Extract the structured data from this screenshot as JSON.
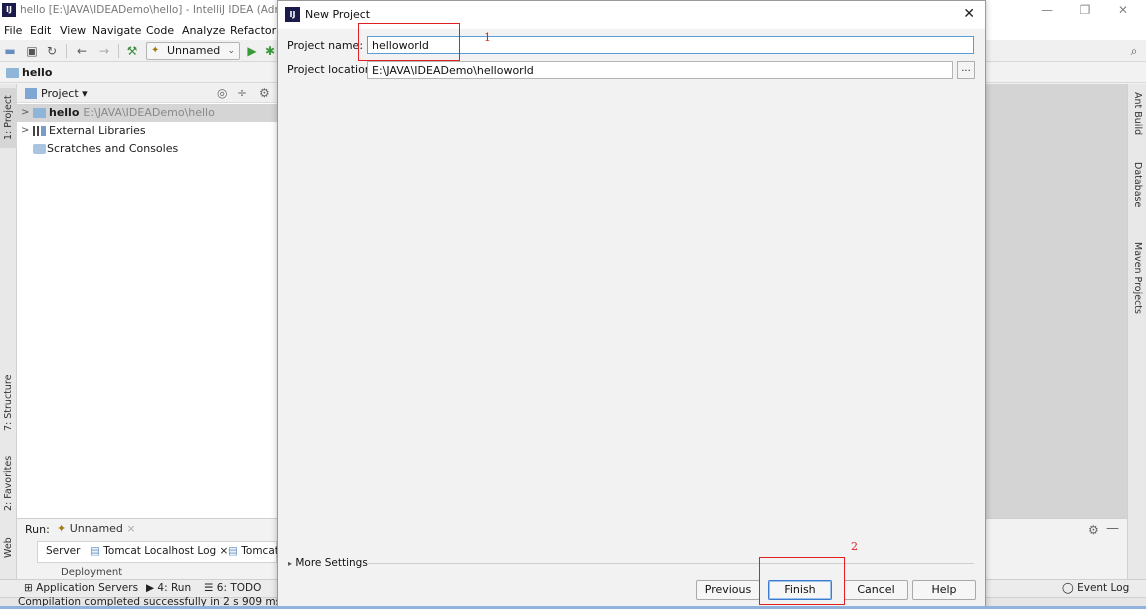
{
  "ide": {
    "title": "hello [E:\\JAVA\\IDEADemo\\hello] - IntelliJ IDEA (Admir",
    "app_icon": "IJ",
    "window_controls": {
      "minimize": "—",
      "maximize": "❐",
      "close": "✕"
    },
    "menu": [
      "File",
      "Edit",
      "View",
      "Navigate",
      "Code",
      "Analyze",
      "Refactor"
    ],
    "run_config": "Unnamed",
    "breadcrumb": "hello",
    "project_panel": {
      "title": "Project",
      "tree": [
        {
          "arrow": ">",
          "label": "hello",
          "path": "E:\\JAVA\\IDEADemo\\hello",
          "selected": true
        },
        {
          "arrow": ">",
          "label": "External Libraries",
          "path": "",
          "selected": false
        },
        {
          "arrow": "",
          "label": "Scratches and Consoles",
          "path": "",
          "selected": false
        }
      ]
    },
    "left_tabs": {
      "project": "1: Project",
      "structure": "7: Structure",
      "favorites": "2: Favorites",
      "web": "Web"
    },
    "right_tabs": {
      "ant": "Ant Build",
      "database": "Database",
      "maven": "Maven Projects"
    },
    "run_panel": {
      "label": "Run:",
      "tab": "Unnamed",
      "subtabs": [
        "Server",
        "Tomcat Localhost Log",
        "Tomcat"
      ],
      "deployment": "Deployment"
    },
    "bottom_tools": {
      "app_servers": "Application Servers",
      "run": "4: Run",
      "todo": "6: TODO",
      "event_log": "Event Log"
    },
    "status": "Compilation completed successfully in 2 s 909 ms (2"
  },
  "dialog": {
    "title": "New Project",
    "close": "✕",
    "project_name_label": "Project name:",
    "project_name_value": "helloworld",
    "project_location_label": "Project location:",
    "project_location_value": "E:\\JAVA\\IDEADemo\\helloworld",
    "browse": "...",
    "more_settings": "More Settings",
    "buttons": {
      "previous": "Previous",
      "finish": "Finish",
      "cancel": "Cancel",
      "help": "Help"
    }
  },
  "annotations": {
    "one": "1",
    "two": "2",
    "color": "#e02020"
  }
}
